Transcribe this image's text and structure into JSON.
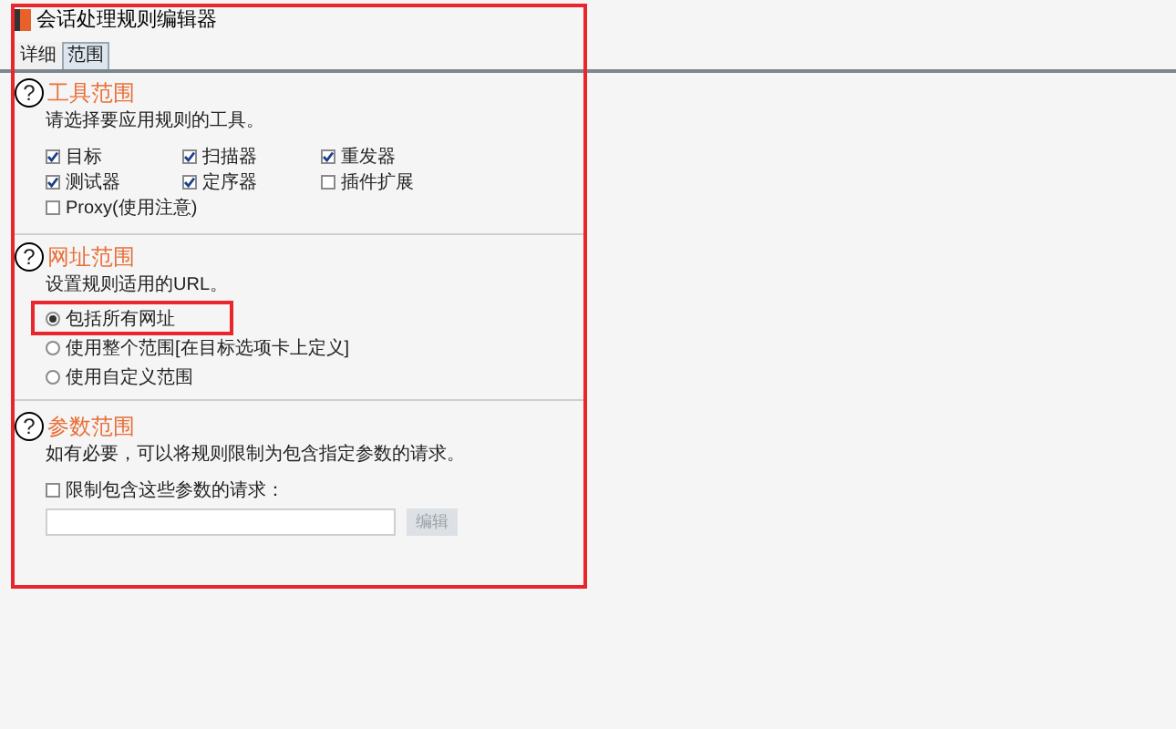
{
  "window": {
    "title": "会话处理规则编辑器"
  },
  "tabs": [
    {
      "label": "详细",
      "selected": false
    },
    {
      "label": "范围",
      "selected": true
    }
  ],
  "tool_scope": {
    "help": "?",
    "title": "工具范围",
    "description": "请选择要应用规则的工具。",
    "tools": [
      {
        "label": "目标",
        "checked": true
      },
      {
        "label": "扫描器",
        "checked": true
      },
      {
        "label": "重发器",
        "checked": true
      },
      {
        "label": "测试器",
        "checked": true
      },
      {
        "label": "定序器",
        "checked": true
      },
      {
        "label": "插件扩展",
        "checked": false
      },
      {
        "label": "Proxy(使用注意)",
        "checked": false
      }
    ]
  },
  "url_scope": {
    "help": "?",
    "title": "网址范围",
    "description": "设置规则适用的URL。",
    "options": [
      {
        "label": "包括所有网址",
        "selected": true
      },
      {
        "label": "使用整个范围[在目标选项卡上定义]",
        "selected": false
      },
      {
        "label": "使用自定义范围",
        "selected": false
      }
    ]
  },
  "param_scope": {
    "help": "?",
    "title": "参数范围",
    "description": "如有必要，可以将规则限制为包含指定参数的请求。",
    "restrict": {
      "label": "限制包含这些参数的请求：",
      "checked": false
    },
    "edit_button": {
      "label": "编辑",
      "disabled": true
    }
  }
}
